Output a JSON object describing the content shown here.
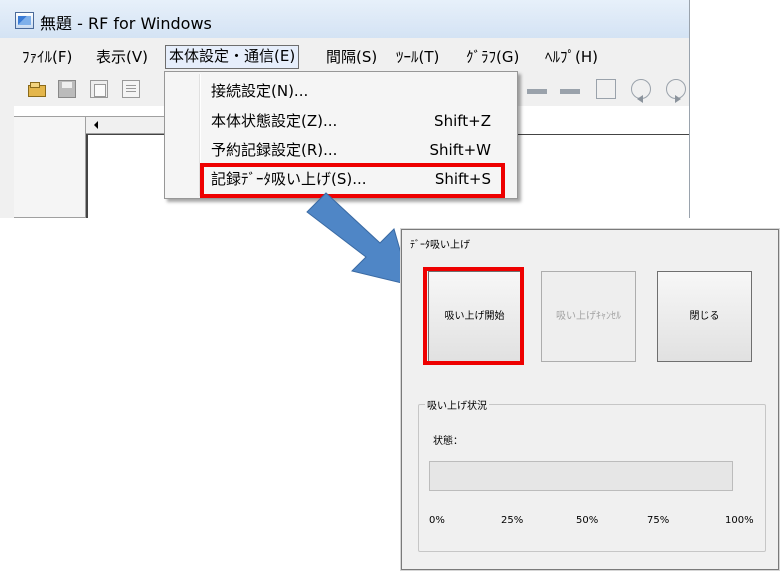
{
  "window": {
    "title": "無題 - RF for Windows"
  },
  "menu": {
    "items": [
      "ﾌｧｲﾙ(F)",
      "表示(V)",
      "本体設定・通信(E)",
      "間隔(S)",
      "ﾂｰﾙ(T)",
      "ｸﾞﾗﾌ(G)",
      "ﾍﾙﾌﾟ(H)"
    ],
    "active_index": 2
  },
  "dropdown": {
    "items": [
      {
        "label": "接続設定(N)...",
        "shortcut": ""
      },
      {
        "label": "本体状態設定(Z)...",
        "shortcut": "Shift+Z"
      },
      {
        "label": "予約記録設定(R)...",
        "shortcut": "Shift+W"
      },
      {
        "label": "記録ﾃﾞｰﾀ吸い上げ(S)...",
        "shortcut": "Shift+S"
      }
    ],
    "highlighted_index": 3
  },
  "toolbar": {
    "icons": [
      "open-folder-icon",
      "save-icon",
      "copy-icon",
      "doc-icon",
      "bar-icon",
      "bar-icon",
      "zoom-fit-icon",
      "rewind-icon",
      "forward-icon"
    ]
  },
  "dialog": {
    "title": "ﾃﾞｰﾀ吸い上げ",
    "buttons": {
      "start": "吸い上げ開始",
      "cancel": "吸い上げｷｬﾝｾﾙ",
      "close": "閉じる"
    },
    "cancel_enabled": false,
    "status_group_label": "吸い上げ状況",
    "status_label": "状態：",
    "progress": 0,
    "ticks": [
      "0%",
      "25%",
      "50%",
      "75%",
      "100%"
    ]
  },
  "colors": {
    "highlight": "#ee0000",
    "arrow": "#4f86c6"
  }
}
